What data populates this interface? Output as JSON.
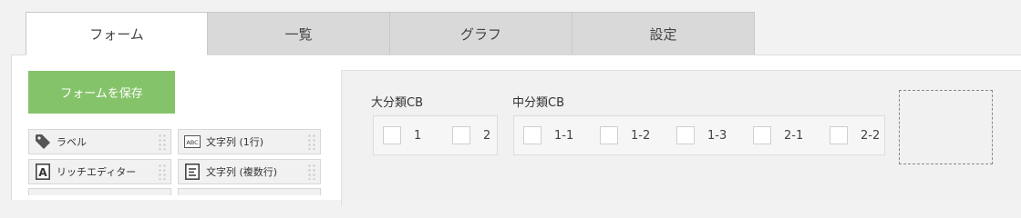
{
  "tabs": [
    {
      "label": "フォーム",
      "active": true
    },
    {
      "label": "一覧",
      "active": false
    },
    {
      "label": "グラフ",
      "active": false
    },
    {
      "label": "設定",
      "active": false
    }
  ],
  "palette": {
    "save_label": "フォームを保存",
    "items": [
      {
        "label": "ラベル",
        "icon": "tag-icon"
      },
      {
        "label": "文字列 (1行)",
        "icon": "abc-text-icon"
      },
      {
        "label": "リッチエディター",
        "icon": "letter-a-icon"
      },
      {
        "label": "文字列 (複数行)",
        "icon": "multiline-text-icon"
      }
    ]
  },
  "form": {
    "group1": {
      "label": "大分類CB",
      "options": [
        "1",
        "2"
      ]
    },
    "group2": {
      "label": "中分類CB",
      "options": [
        "1-1",
        "1-2",
        "1-3",
        "2-1",
        "2-2"
      ]
    }
  },
  "colors": {
    "save_button": "#85c36a",
    "tab_inactive": "#d9d9d9",
    "tab_active": "#ffffff"
  }
}
